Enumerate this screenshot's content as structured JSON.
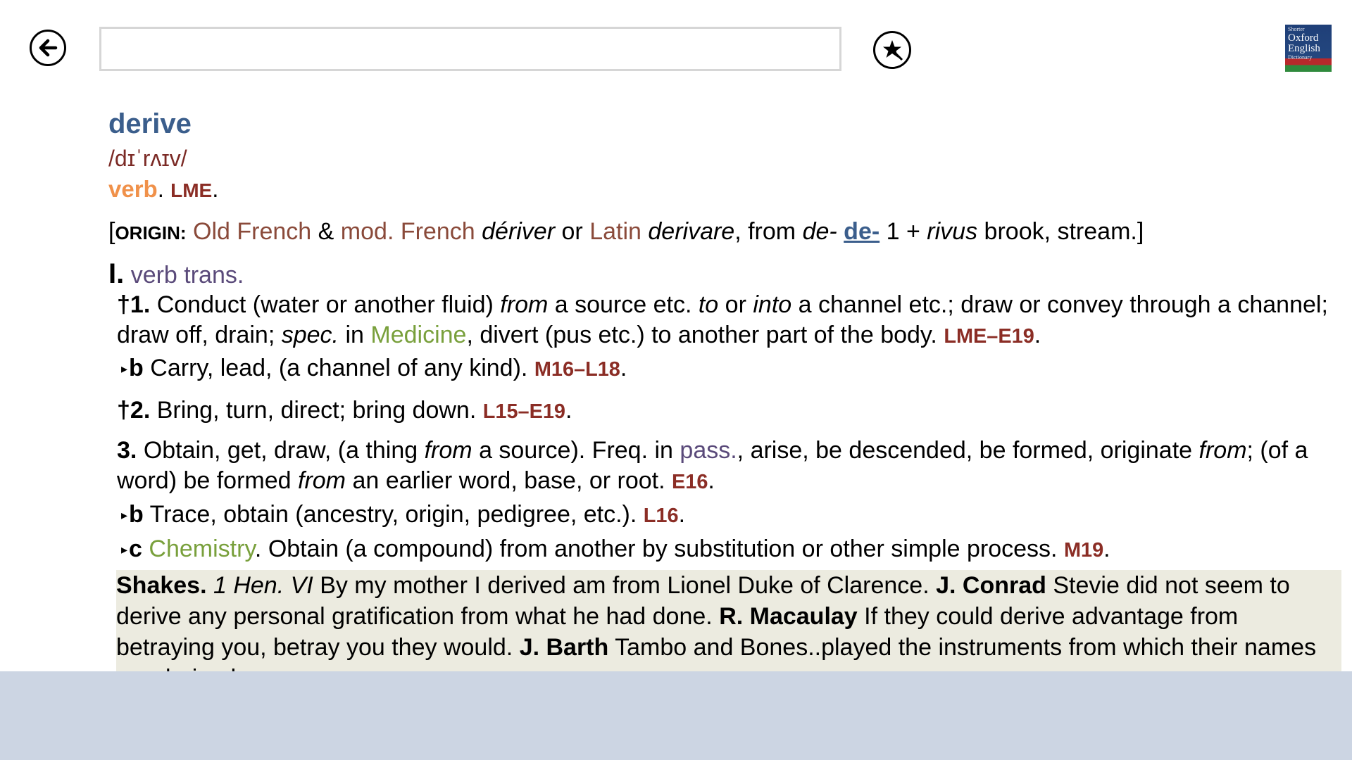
{
  "toolbar": {
    "back_icon": "back-arrow-icon",
    "search_value": "",
    "search_placeholder": "",
    "favorite_icon": "star-bookmark-icon",
    "logo": {
      "line1": "Shorter",
      "line2": "Oxford",
      "line3": "English",
      "line4": "Dictionary"
    }
  },
  "entry": {
    "headword": "derive",
    "pronunciation": "/dɪˈrʌɪv/",
    "pos": "verb",
    "pos_date": "LME",
    "origin": {
      "label": "ORIGIN:",
      "lang1": "Old French",
      "amp": "&",
      "lang2": "mod. French",
      "word1": "dériver",
      "or": "or",
      "lang3": "Latin",
      "word2": "derivare",
      "from": ", from",
      "word3": "de-",
      "xref": "de-",
      "num": "1 +",
      "word4": "rivus",
      "gloss": "brook, stream.]"
    },
    "section": {
      "numeral": "I.",
      "label": "verb trans."
    },
    "senses": {
      "s1": {
        "num": "†1.",
        "t1": "Conduct (water or another fluid)",
        "i1": "from",
        "t2": "a source etc.",
        "i2": "to",
        "t3": "or",
        "i3": "into",
        "t4": "a channel etc.; draw or convey through a channel; draw off, drain;",
        "i4": "spec.",
        "t5": "in",
        "subject": "Medicine",
        "t6": ", divert (pus etc.) to another part of the body.",
        "date": "LME–E19"
      },
      "s1b": {
        "letter": "b",
        "text": "Carry, lead, (a channel of any kind).",
        "date": "M16–L18"
      },
      "s2": {
        "num": "†2.",
        "text": "Bring, turn, direct; bring down.",
        "date": "L15–E19"
      },
      "s3": {
        "num": "3.",
        "t1": "Obtain, get, draw, (a thing",
        "i1": "from",
        "t2": "a source). Freq. in",
        "link": "pass.",
        "t3": ", arise, be descended, be formed, originate",
        "i2": "from",
        "t4": "; (of a word) be formed",
        "i3": "from",
        "t5": "an earlier word, base, or root.",
        "date": "E16"
      },
      "s3b": {
        "letter": "b",
        "text": "Trace, obtain (ancestry, origin, pedigree, etc.).",
        "date": "L16"
      },
      "s3c": {
        "letter": "c",
        "subject": "Chemistry",
        "text": ". Obtain (a compound) from another by substitution or other simple process.",
        "date": "M19"
      }
    },
    "quotations": {
      "a1": "Shakes.",
      "w1": "1 Hen. VI",
      "q1": "By my mother I derived am from Lionel Duke of Clarence.",
      "a2": "J. Conrad",
      "q2": "Stevie did not seem to derive any personal gratification from what he had done.",
      "a3": "R. Macaulay",
      "q3": "If they could derive advantage from betraying you, betray you they would.",
      "a4": "J. Barth",
      "q4": "Tambo and Bones..played the instruments from which their names are derived."
    }
  }
}
